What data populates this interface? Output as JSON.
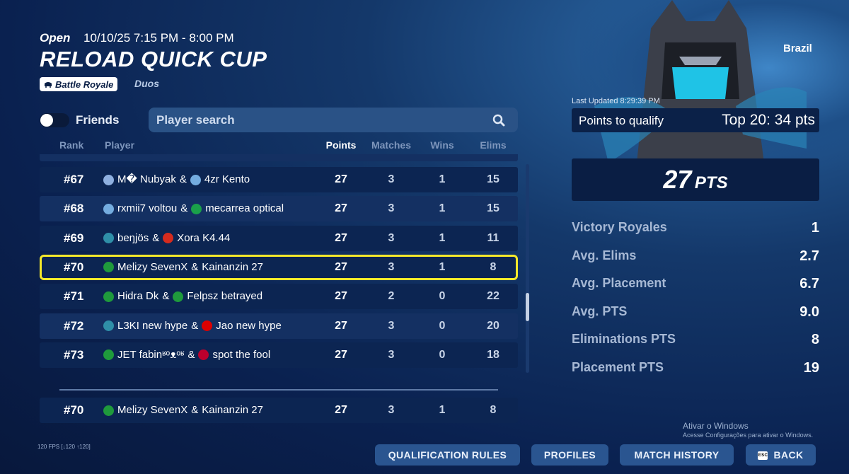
{
  "event": {
    "status": "Open",
    "time": "10/10/25 7:15 PM - 8:00 PM",
    "title": "RELOAD QUICK CUP",
    "mode": "Battle Royale",
    "team_size": "Duos"
  },
  "filters": {
    "friends_label": "Friends",
    "friends_toggle_on": false,
    "search_placeholder": "Player search"
  },
  "table": {
    "headers": {
      "rank": "Rank",
      "player": "Player",
      "points": "Points",
      "matches": "Matches",
      "wins": "Wins",
      "elims": "Elims"
    },
    "rows": [
      {
        "rank": "#67",
        "p1": "M� Nubyak",
        "f1": "uruguay",
        "p2": "4zr Kento",
        "f2": "argentina",
        "points": "27",
        "matches": "3",
        "wins": "1",
        "elims": "15"
      },
      {
        "rank": "#68",
        "p1": "rxmii7 voltou",
        "f1": "argentina",
        "p2": "mecarrea optical",
        "f2": "italy",
        "points": "27",
        "matches": "3",
        "wins": "1",
        "elims": "15"
      },
      {
        "rank": "#69",
        "p1": "beŋjös",
        "f1": "globe",
        "p2": "Xora K4.44",
        "f2": "canada",
        "points": "27",
        "matches": "3",
        "wins": "1",
        "elims": "11"
      },
      {
        "rank": "#70",
        "p1": "Melizy SevenX",
        "f1": "brazil",
        "p2": "Kainanzin 27",
        "f2": "",
        "points": "27",
        "matches": "3",
        "wins": "1",
        "elims": "8"
      },
      {
        "rank": "#71",
        "p1": "Hidra Dk",
        "f1": "brazil",
        "p2": "Felpsz betrayed",
        "f2": "brazil",
        "points": "27",
        "matches": "2",
        "wins": "0",
        "elims": "22"
      },
      {
        "rank": "#72",
        "p1": "L3KI new hype",
        "f1": "globe",
        "p2": "Jao new hype",
        "f2": "germany",
        "points": "27",
        "matches": "3",
        "wins": "0",
        "elims": "20"
      },
      {
        "rank": "#73",
        "p1": "JET fabinʶᵒᴥᵒʶ",
        "f1": "brazil",
        "p2": "spot the fool",
        "f2": "japan",
        "points": "27",
        "matches": "3",
        "wins": "0",
        "elims": "18"
      }
    ],
    "my_row": {
      "rank": "#70",
      "p1": "Melizy SevenX",
      "f1": "brazil",
      "p2": "Kainanzin 27",
      "f2": "",
      "points": "27",
      "matches": "3",
      "wins": "1",
      "elims": "8"
    }
  },
  "summary": {
    "region": "Brazil",
    "last_updated": "Last Updated 8:29:39 PM",
    "qualify_label": "Points to qualify",
    "qualify_value": "Top 20: 34 pts",
    "total_points": "27",
    "total_points_unit": "PTS",
    "stats": [
      {
        "label": "Victory Royales",
        "value": "1"
      },
      {
        "label": "Avg. Elims",
        "value": "2.7"
      },
      {
        "label": "Avg. Placement",
        "value": "6.7"
      },
      {
        "label": "Avg. PTS",
        "value": "9.0"
      },
      {
        "label": "Eliminations PTS",
        "value": "8"
      },
      {
        "label": "Placement PTS",
        "value": "19"
      }
    ]
  },
  "footer": {
    "fps": "120 FPS [↓120 ↑120]",
    "watermark_title": "Ativar o Windows",
    "watermark_sub": "Acesse Configurações para ativar o Windows.",
    "buttons": {
      "qualification_rules": "QUALIFICATION RULES",
      "profiles": "PROFILES",
      "match_history": "MATCH HISTORY",
      "back": "BACK",
      "back_key": "ESC"
    }
  },
  "colors": {
    "highlight": "#f5e92a",
    "flags": {
      "brazil": "#1f9a3c",
      "argentina": "#74acdf",
      "uruguay": "#8fb0e0",
      "italy": "#1aa04a",
      "canada": "#d52b1e",
      "germany": "#dd0000",
      "japan": "#bc002d",
      "globe": "#2f8fa8"
    }
  }
}
